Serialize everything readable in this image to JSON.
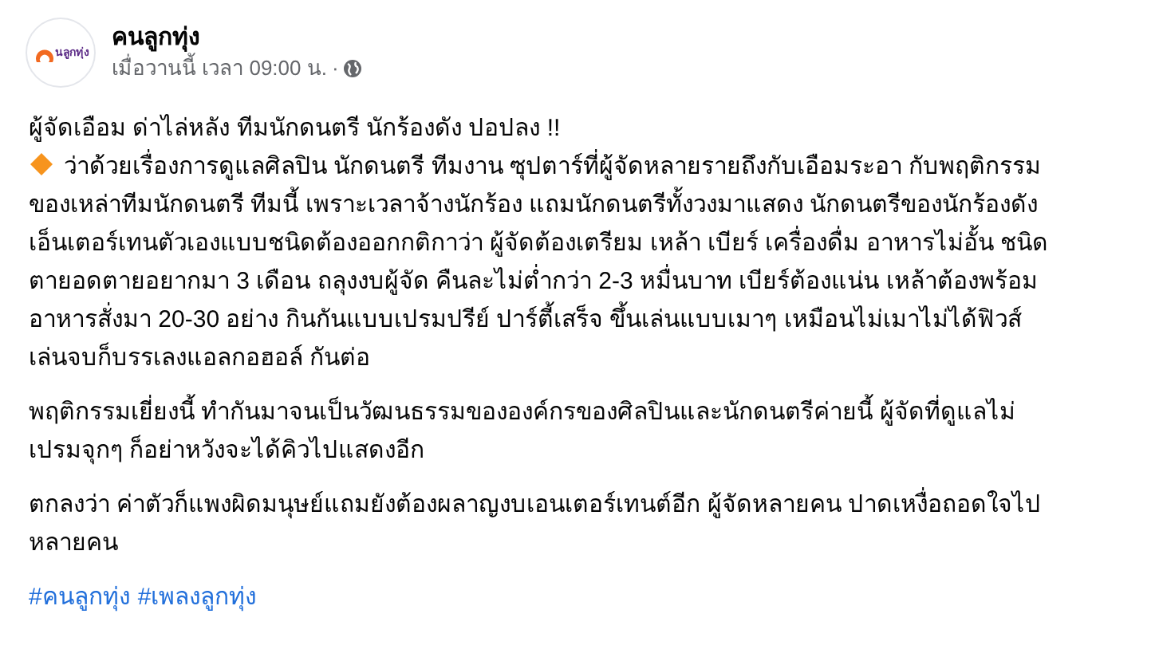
{
  "post": {
    "author": "คนลูกทุ่ง",
    "avatar_text": "นลูกทุ่ง",
    "timestamp": "เมื่อวานนี้ เวลา 09:00 น.",
    "separator": "·"
  },
  "blocks": [
    {
      "kind": "headline",
      "text": "ผู้จัดเอือม ด่าไล่หลัง ทีมนักดนตรี นักร้องดัง ปอปลง !!"
    },
    {
      "kind": "diamond",
      "text": "ว่าด้วยเรื่องการดูแลศิลปิน นักดนตรี ทีมงาน ซุปตาร์ที่ผู้จัดหลายรายถึงกับเอือมระอา กับพฤติกรรมของเหล่าทีมนักดนตรี ทีมนี้ เพราะเวลาจ้างนักร้อง แถมนักดนตรีทั้งวงมาแสดง นักดนตรีของนักร้องดัง เอ็นเตอร์เทนตัวเองแบบชนิดต้องออกกติกาว่า ผู้จัดต้องเตรียม เหล้า เบียร์ เครื่องดื่ม อาหารไม่อั้น ชนิดตายอดตายอยากมา 3 เดือน ถลุงงบผู้จัด คืนละไม่ต่ำกว่า 2-3 หมื่นบาท เบียร์ต้องแน่น เหล้าต้องพร้อม อาหารสั่งมา 20-30 อย่าง กินกันแบบเปรมปรีย์ ปาร์ตี้เสร็จ ขึ้นเล่นแบบเมาๆ เหมือนไม่เมาไม่ได้ฟิวส์ เล่นจบก็บรรเลงแอลกอฮอล์ กันต่อ"
    },
    {
      "kind": "plain",
      "text": "พฤติกรรมเยี่ยงนี้ ทำกันมาจนเป็นวัฒนธรรมขององค์กรของศิลปินและนักดนตรีค่ายนี้  ผู้จัดที่ดูแลไม่เปรมจุกๆ ก็อย่าหวังจะได้คิวไปแสดงอีก"
    },
    {
      "kind": "plain",
      "text": "ตกลงว่า ค่าตัวก็แพงผิดมนุษย์แถมยังต้องผลาญงบเอนเตอร์เทนต์อีก ผู้จัดหลายคน ปาดเหงื่อถอดใจไปหลายคน"
    }
  ],
  "hashtags": [
    "#คนลูกทุ่ง",
    "#เพลงลูกทุ่ง"
  ]
}
